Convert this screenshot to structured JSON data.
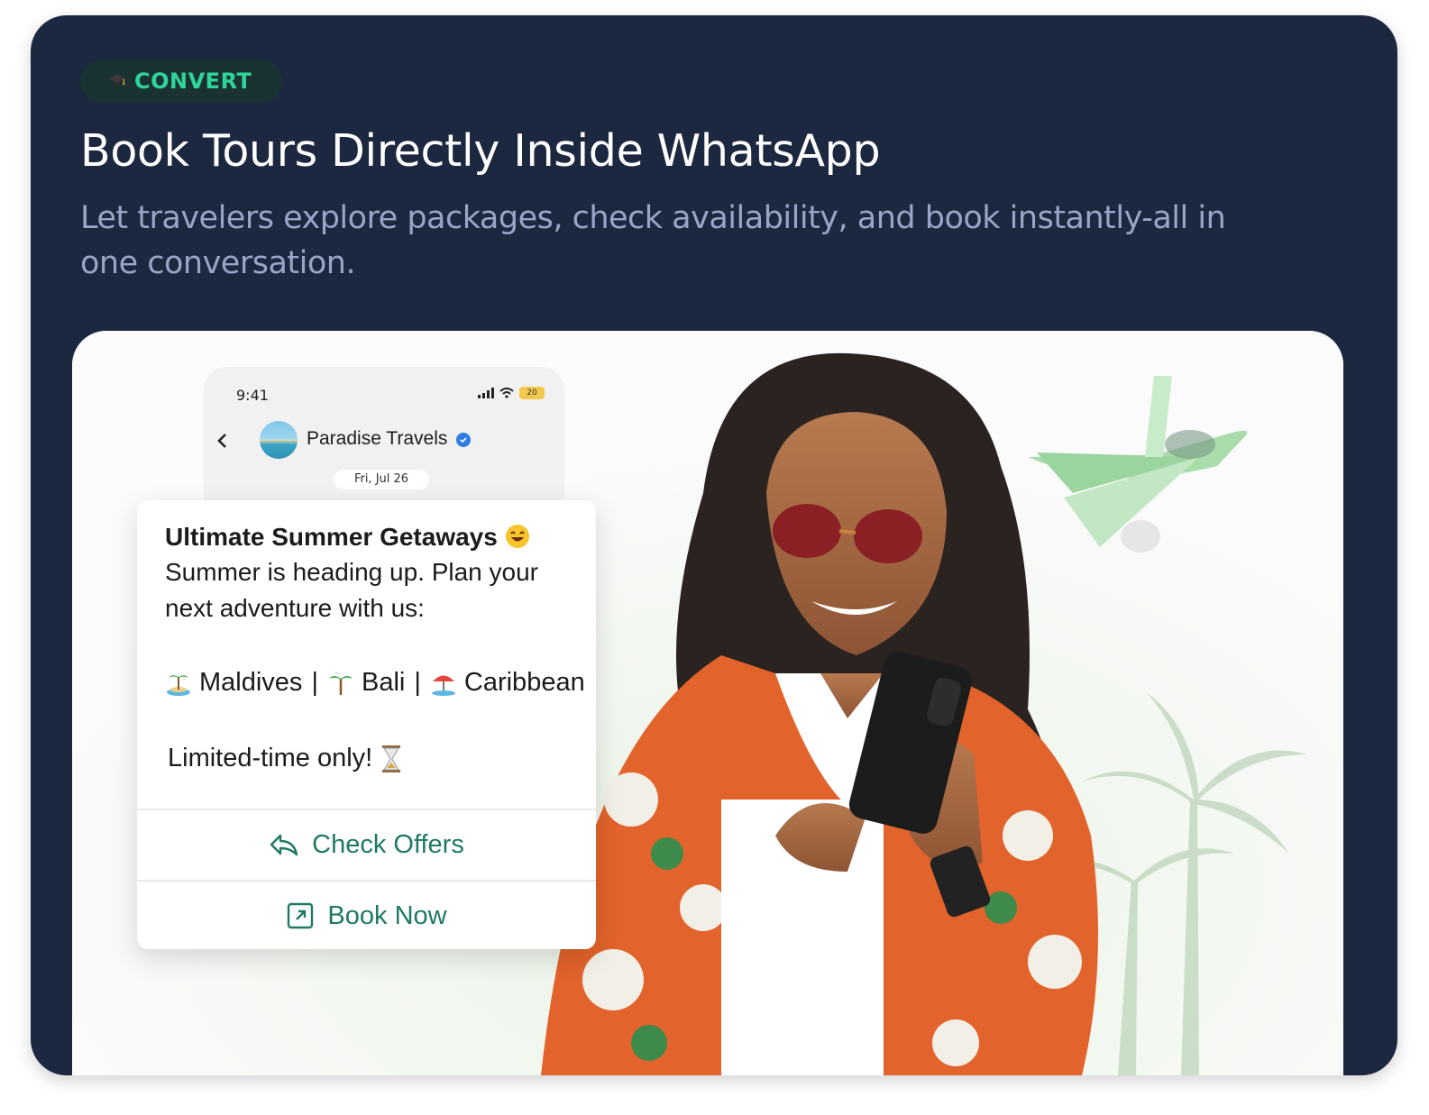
{
  "badge": {
    "label": "CONVERT",
    "icon": "graduation-cap-icon"
  },
  "title": "Book Tours Directly Inside WhatsApp",
  "subtitle": "Let travelers explore packages, check availability, and book instantly-all in one conversation.",
  "phone": {
    "time": "9:41",
    "battery": "20",
    "contact_name": "Paradise Travels",
    "date": "Fri, Jul 26"
  },
  "message": {
    "title": "Ultimate Summer Getaways",
    "body": "Summer is heading up. Plan your next adventure with us:",
    "destinations": [
      {
        "icon": "island-icon",
        "label": "Maldives"
      },
      {
        "icon": "palm-tree-icon",
        "label": "Bali"
      },
      {
        "icon": "beach-umbrella-icon",
        "label": "Caribbean"
      }
    ],
    "separator": "|",
    "footer": "Limited-time only!",
    "buttons": [
      {
        "label": "Check Offers",
        "icon": "reply-arrow-icon"
      },
      {
        "label": "Book Now",
        "icon": "external-link-icon"
      }
    ]
  },
  "colors": {
    "card_bg": "#1c2840",
    "badge_text": "#2fd498",
    "subtitle": "#97a6c5",
    "button_text": "#1f7a63"
  }
}
